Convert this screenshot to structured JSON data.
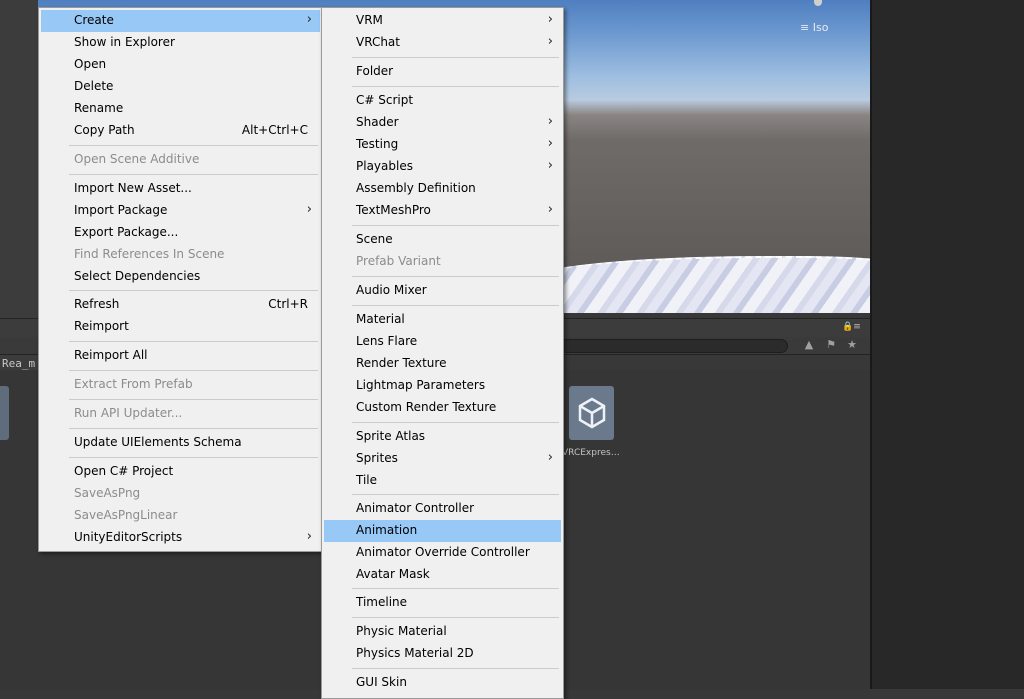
{
  "scene": {
    "view_mode": "Iso"
  },
  "project": {
    "breadcrumb_fragment": "Rea_m",
    "asset_label": "VRCExpres…"
  },
  "main_menu": {
    "items": [
      {
        "label": "Create",
        "submenu": true,
        "highlighted": true
      },
      {
        "label": "Show in Explorer"
      },
      {
        "label": "Open"
      },
      {
        "label": "Delete"
      },
      {
        "label": "Rename"
      },
      {
        "label": "Copy Path",
        "shortcut": "Alt+Ctrl+C"
      },
      {
        "label": "Open Scene Additive",
        "disabled": true
      },
      {
        "label": "Import New Asset..."
      },
      {
        "label": "Import Package",
        "submenu": true
      },
      {
        "label": "Export Package..."
      },
      {
        "label": "Find References In Scene",
        "disabled": true
      },
      {
        "label": "Select Dependencies"
      },
      {
        "label": "Refresh",
        "shortcut": "Ctrl+R"
      },
      {
        "label": "Reimport"
      },
      {
        "label": "Reimport All"
      },
      {
        "label": "Extract From Prefab",
        "disabled": true
      },
      {
        "label": "Run API Updater...",
        "disabled": true
      },
      {
        "label": "Update UIElements Schema"
      },
      {
        "label": "Open C# Project"
      },
      {
        "label": "SaveAsPng",
        "disabled": true
      },
      {
        "label": "SaveAsPngLinear",
        "disabled": true
      },
      {
        "label": "UnityEditorScripts",
        "submenu": true
      }
    ]
  },
  "create_menu": {
    "items": [
      {
        "label": "VRM",
        "submenu": true
      },
      {
        "label": "VRChat",
        "submenu": true
      },
      {
        "label": "Folder"
      },
      {
        "label": "C# Script"
      },
      {
        "label": "Shader",
        "submenu": true
      },
      {
        "label": "Testing",
        "submenu": true
      },
      {
        "label": "Playables",
        "submenu": true
      },
      {
        "label": "Assembly Definition"
      },
      {
        "label": "TextMeshPro",
        "submenu": true
      },
      {
        "label": "Scene"
      },
      {
        "label": "Prefab Variant",
        "disabled": true
      },
      {
        "label": "Audio Mixer"
      },
      {
        "label": "Material"
      },
      {
        "label": "Lens Flare"
      },
      {
        "label": "Render Texture"
      },
      {
        "label": "Lightmap Parameters"
      },
      {
        "label": "Custom Render Texture"
      },
      {
        "label": "Sprite Atlas"
      },
      {
        "label": "Sprites",
        "submenu": true
      },
      {
        "label": "Tile"
      },
      {
        "label": "Animator Controller"
      },
      {
        "label": "Animation",
        "highlighted": true
      },
      {
        "label": "Animator Override Controller"
      },
      {
        "label": "Avatar Mask"
      },
      {
        "label": "Timeline"
      },
      {
        "label": "Physic Material"
      },
      {
        "label": "Physics Material 2D"
      },
      {
        "label": "GUI Skin"
      }
    ]
  }
}
